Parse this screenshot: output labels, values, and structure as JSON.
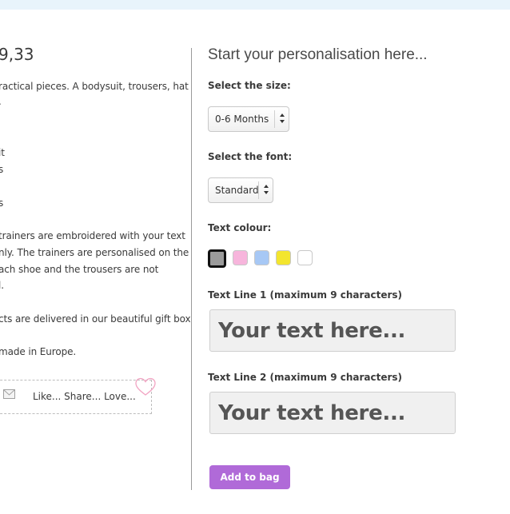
{
  "left": {
    "price": "9,33",
    "lines": [
      "ractical pieces. A bodysuit, trousers, hat",
      ".",
      "it",
      "s",
      "s",
      "trainers are embroidered with your text",
      "nly. The trainers are personalised on the",
      "ach shoe and the trousers are not",
      "l.",
      "cts are delivered in our beautiful gift box.",
      " made in Europe."
    ],
    "social_text": "Like... Share... Love...",
    "mail_icon": "envelope-icon",
    "heart_icon": "heart-icon"
  },
  "right": {
    "title": "Start your personalisation here...",
    "size_label": "Select the size:",
    "size_value": "0-6 Months",
    "font_label": "Select the font:",
    "font_value": "Standard",
    "colour_label": "Text colour:",
    "colours": [
      {
        "name": "grey",
        "hex": "#9b9b9b",
        "selected": true
      },
      {
        "name": "pink",
        "hex": "#f7b5dc",
        "selected": false
      },
      {
        "name": "blue",
        "hex": "#a7c8f5",
        "selected": false
      },
      {
        "name": "yellow",
        "hex": "#f3e52e",
        "selected": false
      },
      {
        "name": "white",
        "hex": "#ffffff",
        "selected": false
      }
    ],
    "line1_label": "Text Line 1 (maximum 9 characters)",
    "line1_placeholder": "Your text here...",
    "line2_label": "Text Line 2 (maximum 9 characters)",
    "line2_placeholder": "Your text here...",
    "add_button": "Add to bag",
    "accent_color": "#b06ad8"
  }
}
